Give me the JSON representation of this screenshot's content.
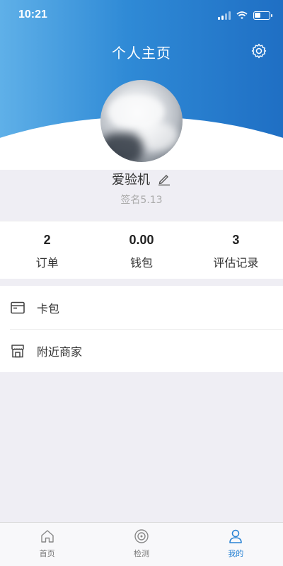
{
  "status_bar": {
    "time": "10:21",
    "battery_level": 0.4
  },
  "header": {
    "title": "个人主页",
    "settings_icon": "gear-icon"
  },
  "profile": {
    "name": "爱验机",
    "signature": "签名5.13",
    "edit_icon": "pencil-icon"
  },
  "stats": [
    {
      "value": "2",
      "label": "订单"
    },
    {
      "value": "0.00",
      "label": "钱包"
    },
    {
      "value": "3",
      "label": "评估记录"
    }
  ],
  "menu": [
    {
      "icon": "card-icon",
      "label": "卡包"
    },
    {
      "icon": "shop-icon",
      "label": "附近商家"
    }
  ],
  "tabbar": {
    "active_index": 2,
    "accent": "#2b84d4",
    "tabs": [
      {
        "icon": "home-icon",
        "label": "首页"
      },
      {
        "icon": "inspect-icon",
        "label": "检测"
      },
      {
        "icon": "user-icon",
        "label": "我的"
      }
    ]
  },
  "colors": {
    "header_start": "#5fb0e8",
    "header_end": "#1f6fc4",
    "background": "#efeef4"
  }
}
